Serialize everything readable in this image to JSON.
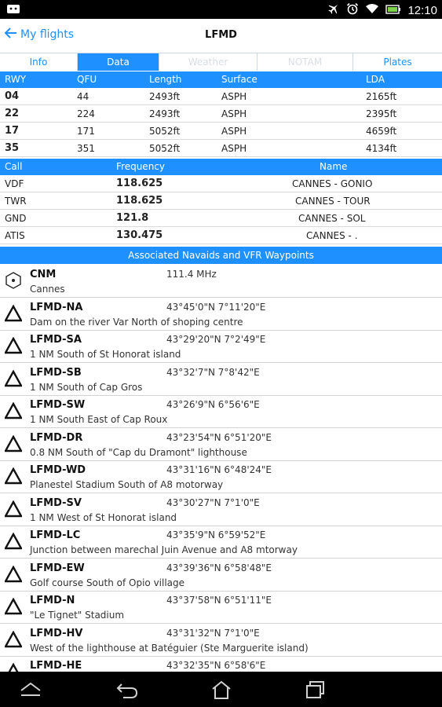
{
  "status": {
    "time": "12:10"
  },
  "header": {
    "back_label": "My flights",
    "title": "LFMD"
  },
  "tabs": [
    {
      "label": "Info",
      "state": "normal"
    },
    {
      "label": "Data",
      "state": "active"
    },
    {
      "label": "Weather",
      "state": "disabled"
    },
    {
      "label": "NOTAM",
      "state": "disabled"
    },
    {
      "label": "Plates",
      "state": "normal"
    }
  ],
  "runways": {
    "columns": [
      "RWY",
      "QFU",
      "Length",
      "Surface",
      "LDA"
    ],
    "rows": [
      [
        "04",
        "44",
        "2493ft",
        "ASPH",
        "2165ft"
      ],
      [
        "22",
        "224",
        "2493ft",
        "ASPH",
        "2395ft"
      ],
      [
        "17",
        "171",
        "5052ft",
        "ASPH",
        "4659ft"
      ],
      [
        "35",
        "351",
        "5052ft",
        "ASPH",
        "4134ft"
      ]
    ]
  },
  "frequencies": {
    "columns": [
      "Call",
      "Frequency",
      "Name"
    ],
    "rows": [
      [
        "VDF",
        "118.625",
        "CANNES - GONIO"
      ],
      [
        "TWR",
        "118.625",
        "CANNES - TOUR"
      ],
      [
        "GND",
        "121.8",
        "CANNES - SOL"
      ],
      [
        "ATIS",
        "130.475",
        "CANNES - ."
      ]
    ]
  },
  "navaids": {
    "title": "Associated Navaids and VFR Waypoints",
    "items": [
      {
        "icon": "vor-hexagon-icon",
        "id": "CNM",
        "coord": "111.4 MHz",
        "desc": "Cannes"
      },
      {
        "icon": "waypoint-triangle-icon",
        "id": "LFMD-NA",
        "coord": "43°45'0\"N 7°11'20\"E",
        "desc": "Dam on the river Var North of shoping centre"
      },
      {
        "icon": "waypoint-triangle-icon",
        "id": "LFMD-SA",
        "coord": "43°29'20\"N 7°2'49\"E",
        "desc": "1 NM South of St Honorat island"
      },
      {
        "icon": "waypoint-triangle-icon",
        "id": "LFMD-SB",
        "coord": "43°32'7\"N 7°8'42\"E",
        "desc": "1 NM South of Cap Gros"
      },
      {
        "icon": "waypoint-triangle-icon",
        "id": "LFMD-SW",
        "coord": "43°26'9\"N 6°56'6\"E",
        "desc": "1 NM South East of Cap Roux"
      },
      {
        "icon": "waypoint-triangle-icon",
        "id": "LFMD-DR",
        "coord": "43°23'54\"N 6°51'20\"E",
        "desc": "0.8 NM South of \"Cap du Dramont\" lighthouse"
      },
      {
        "icon": "waypoint-triangle-icon",
        "id": "LFMD-WD",
        "coord": "43°31'16\"N 6°48'24\"E",
        "desc": "Planestel Stadium South of A8 motorway"
      },
      {
        "icon": "waypoint-triangle-icon",
        "id": "LFMD-SV",
        "coord": "43°30'27\"N 7°1'0\"E",
        "desc": "1 NM West of St Honorat island"
      },
      {
        "icon": "waypoint-triangle-icon",
        "id": "LFMD-LC",
        "coord": "43°35'9\"N 6°59'52\"E",
        "desc": "Junction between marechal Juin Avenue and A8 mtorway"
      },
      {
        "icon": "waypoint-triangle-icon",
        "id": "LFMD-EW",
        "coord": "43°39'36\"N 6°58'48\"E",
        "desc": "Golf course South of Opio village"
      },
      {
        "icon": "waypoint-triangle-icon",
        "id": "LFMD-N",
        "coord": "43°37'58\"N 6°51'11\"E",
        "desc": "\"Le Tignet\" Stadium"
      },
      {
        "icon": "waypoint-triangle-icon",
        "id": "LFMD-HV",
        "coord": "43°31'32\"N 7°1'0\"E",
        "desc": "West of the lighthouse at Batéguier (Ste Marguerite island)"
      },
      {
        "icon": "waypoint-triangle-icon",
        "id": "LFMD-HE",
        "coord": "43°32'35\"N 6°58'6\"E",
        "desc": ""
      }
    ]
  },
  "colors": {
    "accent": "#1e90ff",
    "bar": "#000000"
  }
}
